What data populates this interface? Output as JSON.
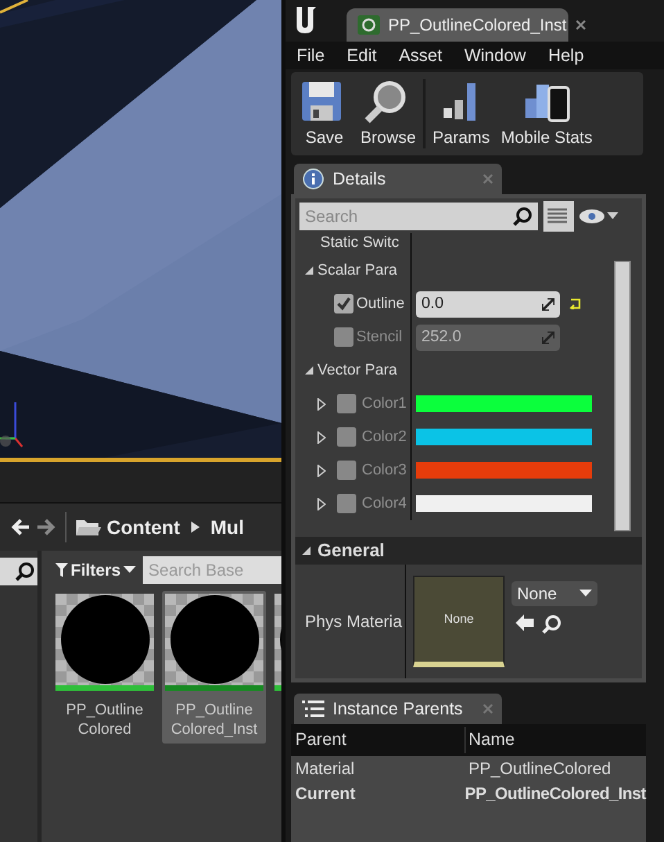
{
  "content_browser": {
    "path": [
      {
        "label": "Content"
      },
      {
        "label": "Mul"
      }
    ],
    "filters": "Filters",
    "search": {
      "placeholder": "Search Base"
    },
    "assets": [
      {
        "label_lines": [
          "PP_Outline",
          "Colored"
        ],
        "selected": false
      },
      {
        "label_lines": [
          "PP_Outline",
          "Colored_Inst"
        ],
        "selected": true
      },
      {
        "selected": false
      }
    ]
  },
  "editor": {
    "tab": {
      "title": "PP_OutlineColored_Inst"
    },
    "menu": [
      "File",
      "Edit",
      "Asset",
      "Window",
      "Help"
    ],
    "toolbar": [
      {
        "label": "Save",
        "kind": "save"
      },
      {
        "label": "Browse",
        "kind": "browse"
      },
      {
        "label": "Params",
        "kind": "params"
      },
      {
        "label": "Mobile Stats",
        "kind": "mobile"
      }
    ]
  },
  "details": {
    "title": "Details",
    "search": {
      "placeholder": "Search"
    },
    "properties": [
      {
        "kind": "item",
        "label": "Static Switc"
      },
      {
        "kind": "category",
        "label": "Scalar Para",
        "expanded": true,
        "children": [
          {
            "kind": "scalar",
            "label": "Outline",
            "checked": true,
            "value": "0.0"
          },
          {
            "kind": "scalar",
            "label": "Stencil",
            "checked": false,
            "value": "252.0"
          }
        ]
      },
      {
        "kind": "category",
        "label": "Vector Para",
        "expanded": true,
        "children": [
          {
            "kind": "color",
            "label": "Color1",
            "checked": false,
            "expanded": false,
            "color": "#0bff3c"
          },
          {
            "kind": "color",
            "label": "Color2",
            "checked": false,
            "expanded": false,
            "color": "#0bc3e6"
          },
          {
            "kind": "color",
            "label": "Color3",
            "checked": false,
            "expanded": false,
            "color": "#e63c0b"
          },
          {
            "kind": "color",
            "label": "Color4",
            "checked": false,
            "expanded": false,
            "color": "#f0f0f0"
          }
        ]
      }
    ],
    "general": {
      "title": "General",
      "expanded": true,
      "label": "Phys Materia",
      "thumbnail_text": "None",
      "combo": "None"
    }
  },
  "instance_parents": {
    "title": "Instance Parents",
    "columns": [
      "Parent",
      "Name"
    ],
    "rows": [
      {
        "cells": [
          "Material",
          "PP_OutlineColored"
        ],
        "current": false
      },
      {
        "cells": [
          "Current",
          "PP_OutlineColored_Inst"
        ],
        "current": true
      }
    ]
  }
}
